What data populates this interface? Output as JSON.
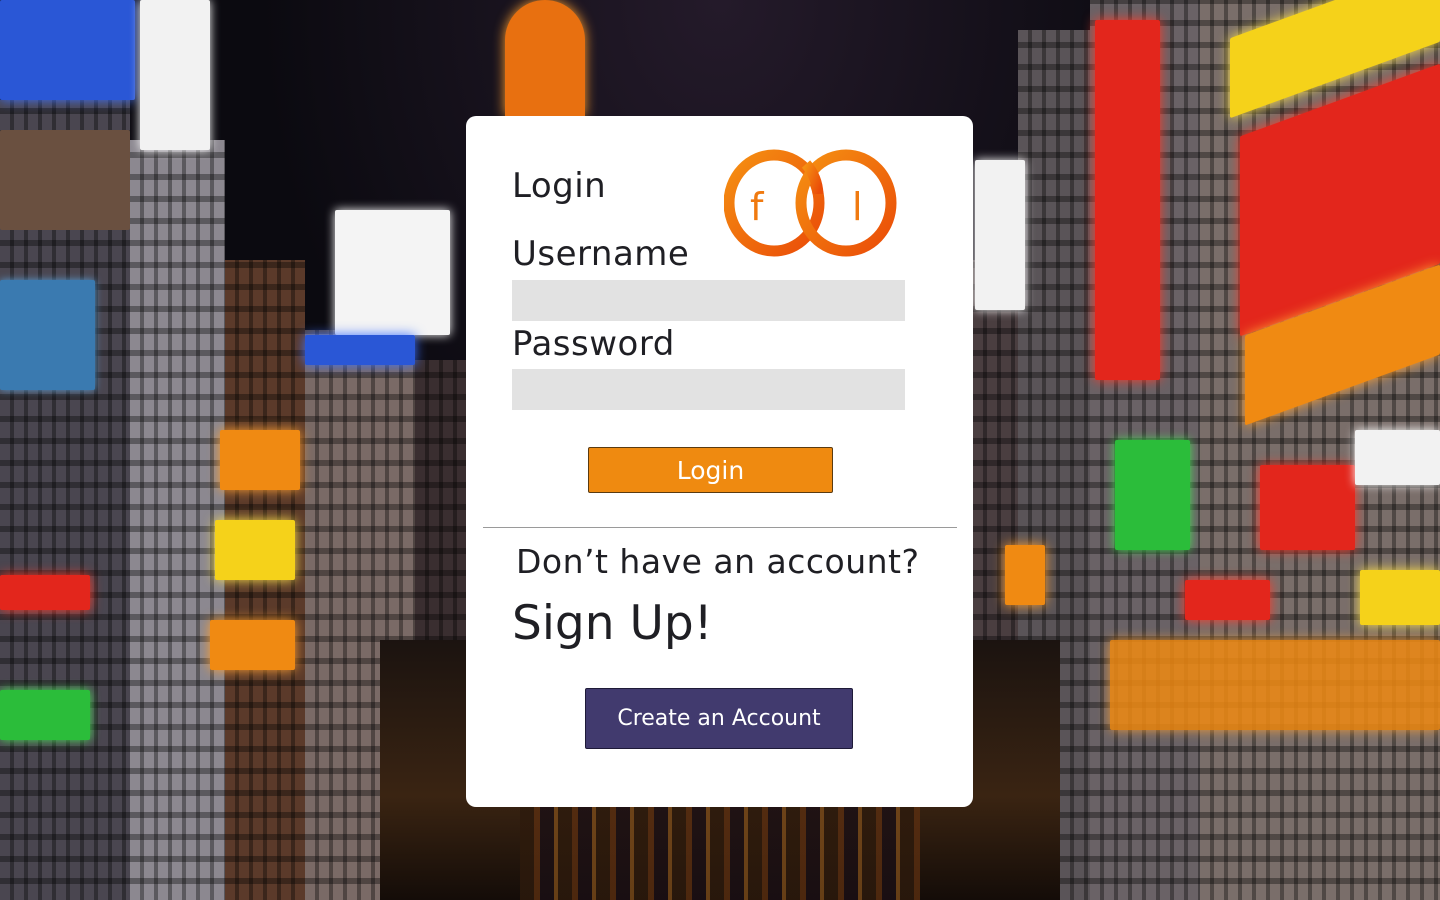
{
  "background": {
    "description_icon": "city-street-night-photo"
  },
  "login_card": {
    "title": "Login",
    "logo": {
      "icon": "interlocking-rings-logo",
      "letters": [
        "f",
        "l"
      ],
      "color": "#f06a0a"
    },
    "username": {
      "label": "Username",
      "value": "",
      "placeholder": ""
    },
    "password": {
      "label": "Password",
      "value": "",
      "placeholder": ""
    },
    "login_button": {
      "label": "Login",
      "color": "#ef8a10"
    }
  },
  "signup": {
    "prompt": "Don’t have an account?",
    "heading": "Sign Up!",
    "create_button": {
      "label": "Create an Account",
      "color": "#413a6e"
    }
  }
}
